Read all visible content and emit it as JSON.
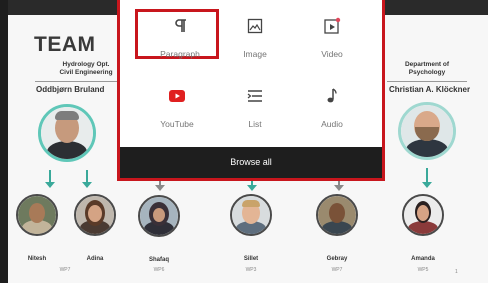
{
  "slide": {
    "title": "TEAM",
    "left_dept": "Hydrology Opt.\nCivil Engineering",
    "left_lead": "Oddbjørn Bruland",
    "right_dept": "Department of\nPsychology",
    "right_lead": "Christian A. Klöckner",
    "members": [
      {
        "name": "Nitesh",
        "role": "WP7"
      },
      {
        "name": "Adina",
        "role": ""
      },
      {
        "name": "Shafaq",
        "role": "WP6"
      },
      {
        "name": "Sillet",
        "role": "WP3"
      },
      {
        "name": "Gebray",
        "role": "WP7"
      },
      {
        "name": "Amanda",
        "role": "WP5"
      }
    ],
    "page_number": "1"
  },
  "inserter": {
    "blocks": [
      {
        "label": "Paragraph",
        "icon": "paragraph-icon",
        "selected": true
      },
      {
        "label": "Image",
        "icon": "image-icon",
        "selected": false
      },
      {
        "label": "Video",
        "icon": "video-icon",
        "selected": false
      },
      {
        "label": "YouTube",
        "icon": "youtube-icon",
        "selected": false
      },
      {
        "label": "List",
        "icon": "list-icon",
        "selected": false
      },
      {
        "label": "Audio",
        "icon": "audio-icon",
        "selected": false
      }
    ],
    "browse_all": "Browse all",
    "highlight_color": "#c8161d"
  }
}
